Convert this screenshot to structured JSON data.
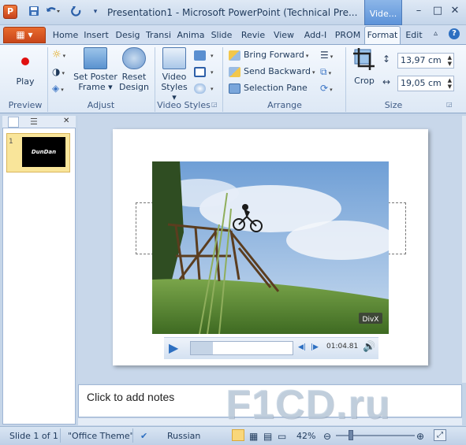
{
  "app": {
    "document_title": "Presentation1  -  Microsoft PowerPoint (Technical Pre...",
    "context_tab_header": "Vide...",
    "window_buttons": {
      "minimize": "–",
      "restore": "□",
      "close": "✕"
    },
    "qat": {
      "save_icon": "save-icon",
      "undo_icon": "undo-icon",
      "redo_icon": "repeat-icon",
      "customize": "▾"
    }
  },
  "tabs": [
    "Home",
    "Insert",
    "Desig",
    "Transi",
    "Anima",
    "Slide",
    "Revie",
    "View",
    "Add-I",
    "PROM",
    "Format",
    "Edit"
  ],
  "active_tab": "Format",
  "ribbon": {
    "preview": {
      "label": "Preview",
      "play": "Play"
    },
    "adjust": {
      "label": "Adjust",
      "poster_frame": "Set Poster\nFrame ▾",
      "poster_line1": "Set Poster",
      "poster_line2": "Frame ▾",
      "reset_line1": "Reset",
      "reset_line2": "Design"
    },
    "video_styles": {
      "label": "Video Styles",
      "styles_line1": "Video",
      "styles_line2": "Styles ▾"
    },
    "arrange": {
      "label": "Arrange",
      "bring_forward": "Bring Forward",
      "send_backward": "Send Backward",
      "selection_pane": "Selection Pane"
    },
    "size": {
      "label": "Size",
      "crop": "Crop",
      "height": "13,97 cm",
      "width": "19,05 cm"
    }
  },
  "slides_pane": {
    "slide_number": "1",
    "thumb_text": "DunDan"
  },
  "video": {
    "time": "01:04.81",
    "watermark_logo": "DivX"
  },
  "notes": {
    "placeholder": "Click to add notes"
  },
  "status": {
    "slide": "Slide 1 of 1",
    "theme": "\"Office Theme\"",
    "language": "Russian",
    "zoom": "42%"
  },
  "watermark": "F1CD.ru",
  "colors": {
    "accent": "#2b579a",
    "file_tab": "#d5501f",
    "ribbon_bg": "#e6eef8"
  }
}
